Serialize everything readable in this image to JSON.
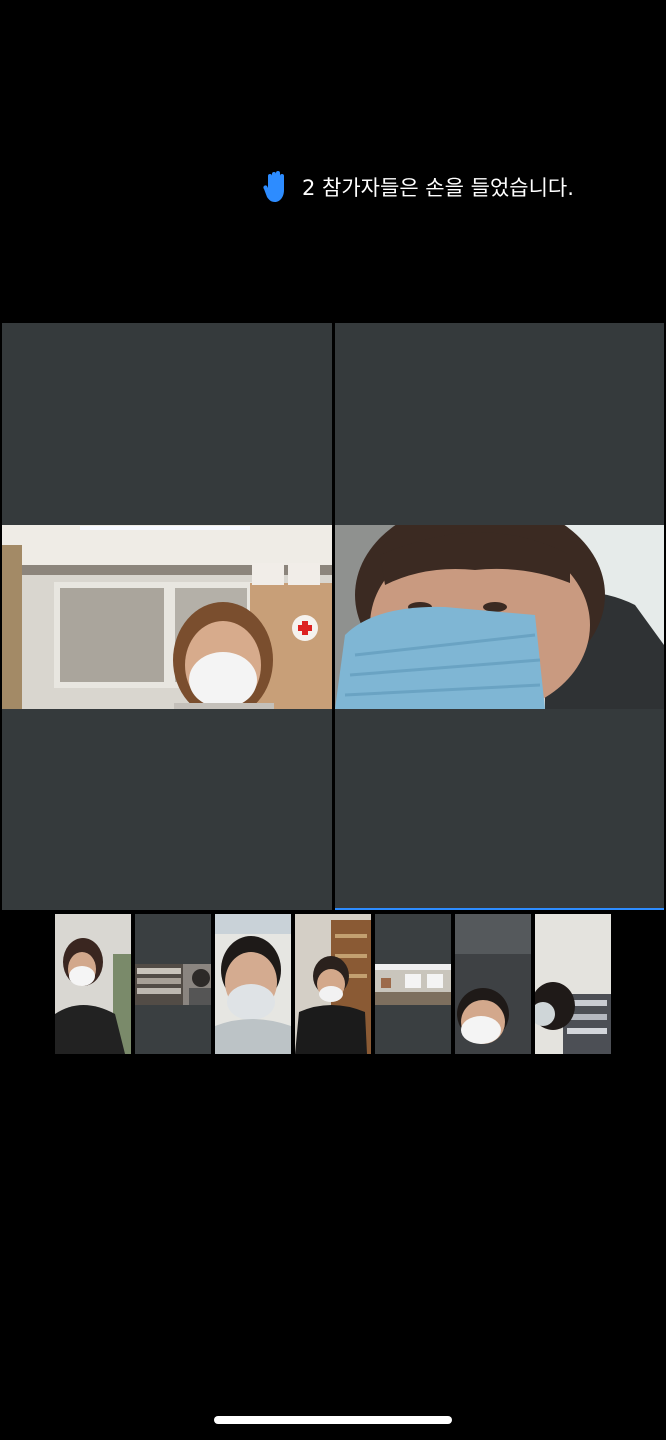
{
  "notification": {
    "text": "2 참가자들은 손을 들었습니다.",
    "icon": "raised-hand-icon",
    "icon_color": "#2d8cff"
  },
  "colors": {
    "background": "#000000",
    "tile_background": "#353a3c",
    "active_speaker_border": "#2d8cff"
  },
  "main_tiles": [
    {
      "id": "participant-a",
      "active_speaker": false
    },
    {
      "id": "participant-b",
      "active_speaker": true
    }
  ],
  "thumbnails": [
    {
      "id": "t1",
      "video": true
    },
    {
      "id": "t2",
      "video": true
    },
    {
      "id": "t3",
      "video": true
    },
    {
      "id": "t4",
      "video": true
    },
    {
      "id": "t5",
      "video": true
    },
    {
      "id": "t6",
      "video": true
    },
    {
      "id": "t7",
      "video": true
    }
  ]
}
